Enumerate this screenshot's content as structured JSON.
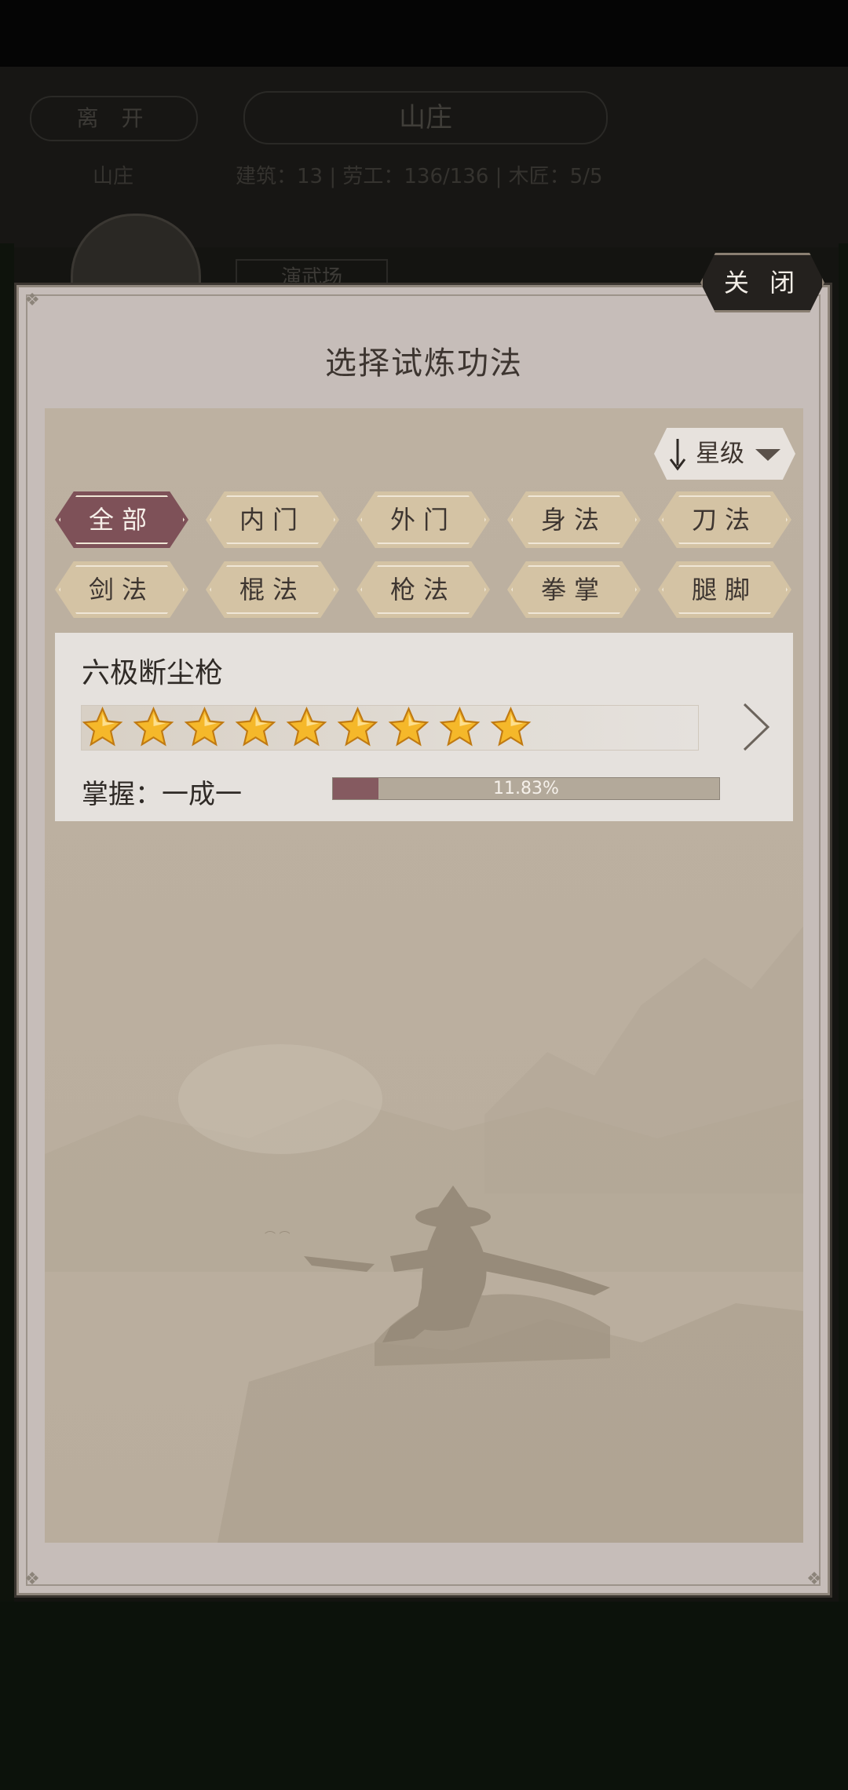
{
  "background": {
    "leave_label": "离 开",
    "location_title": "山庄",
    "left_note": "山庄",
    "stats": "建筑：13  |  劳工：136/136  |  木匠：5/5",
    "building_tag": "演武场"
  },
  "dialog": {
    "close_label": "关 闭",
    "title": "选择试炼功法",
    "sort": {
      "label": "星级",
      "direction": "descending"
    },
    "categories": [
      {
        "label": "全部",
        "active": true
      },
      {
        "label": "内门",
        "active": false
      },
      {
        "label": "外门",
        "active": false
      },
      {
        "label": "身法",
        "active": false
      },
      {
        "label": "刀法",
        "active": false
      },
      {
        "label": "剑法",
        "active": false
      },
      {
        "label": "棍法",
        "active": false
      },
      {
        "label": "枪法",
        "active": false
      },
      {
        "label": "拳掌",
        "active": false
      },
      {
        "label": "腿脚",
        "active": false
      }
    ],
    "techniques": [
      {
        "name": "六极断尘枪",
        "stars": 9,
        "mastery_label": "掌握：一成一",
        "progress_percent": 11.83,
        "progress_text": "11.83%"
      }
    ]
  },
  "colors": {
    "active_chip": "#7e5158",
    "chip": "#d4c3a4",
    "progress_fill": "#855a60",
    "star": "#f5b82a"
  }
}
